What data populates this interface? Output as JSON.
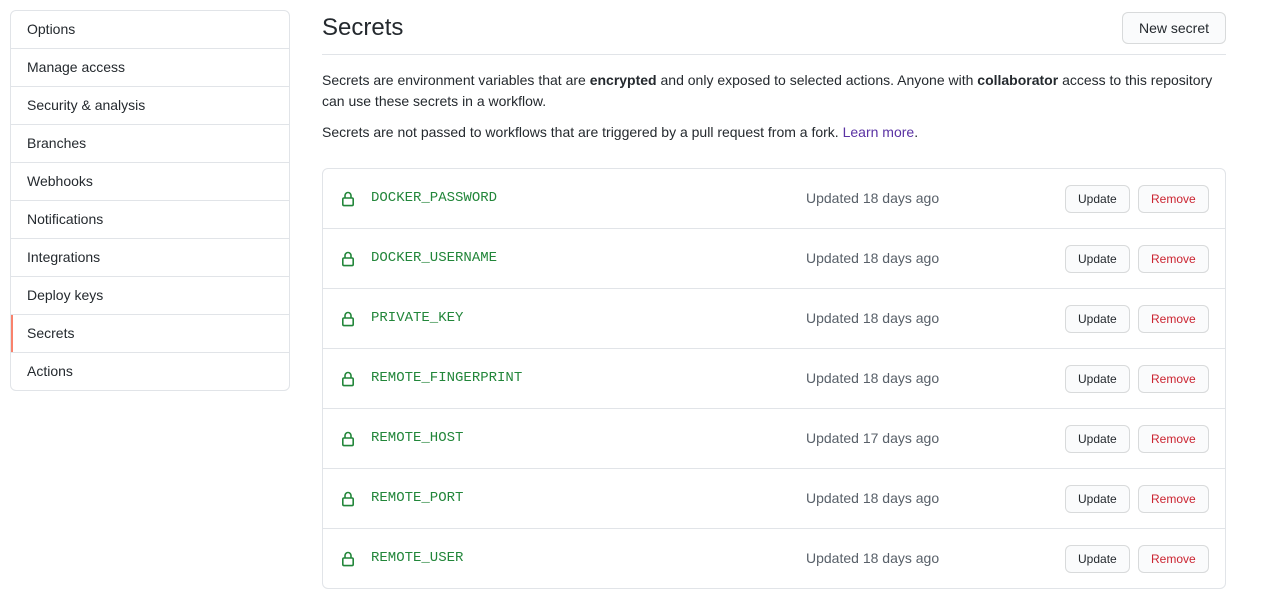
{
  "sidebar": {
    "items": [
      {
        "label": "Options"
      },
      {
        "label": "Manage access"
      },
      {
        "label": "Security & analysis"
      },
      {
        "label": "Branches"
      },
      {
        "label": "Webhooks"
      },
      {
        "label": "Notifications"
      },
      {
        "label": "Integrations"
      },
      {
        "label": "Deploy keys"
      },
      {
        "label": "Secrets",
        "selected": true
      },
      {
        "label": "Actions"
      }
    ]
  },
  "header": {
    "title": "Secrets",
    "new_secret_label": "New secret"
  },
  "description": {
    "p1_part1": "Secrets are environment variables that are ",
    "p1_bold1": "encrypted",
    "p1_part2": " and only exposed to selected actions. Anyone with ",
    "p1_bold2": "collaborator",
    "p1_part3": " access to this repository can use these secrets in a workflow.",
    "p2_text": "Secrets are not passed to workflows that are triggered by a pull request from a fork. ",
    "p2_link": "Learn more",
    "p2_end": "."
  },
  "secrets": {
    "update_label": "Update",
    "remove_label": "Remove",
    "items": [
      {
        "name": "DOCKER_PASSWORD",
        "updated": "Updated 18 days ago"
      },
      {
        "name": "DOCKER_USERNAME",
        "updated": "Updated 18 days ago"
      },
      {
        "name": "PRIVATE_KEY",
        "updated": "Updated 18 days ago"
      },
      {
        "name": "REMOTE_FINGERPRINT",
        "updated": "Updated 18 days ago"
      },
      {
        "name": "REMOTE_HOST",
        "updated": "Updated 17 days ago"
      },
      {
        "name": "REMOTE_PORT",
        "updated": "Updated 18 days ago"
      },
      {
        "name": "REMOTE_USER",
        "updated": "Updated 18 days ago"
      }
    ]
  },
  "colors": {
    "accent_selected": "#f9826c",
    "secret_name": "#22863a",
    "lock_icon": "#22863a",
    "remove_text": "#cb2431",
    "link": "#5a32a3"
  },
  "icons": {
    "lock": "lock-icon"
  }
}
